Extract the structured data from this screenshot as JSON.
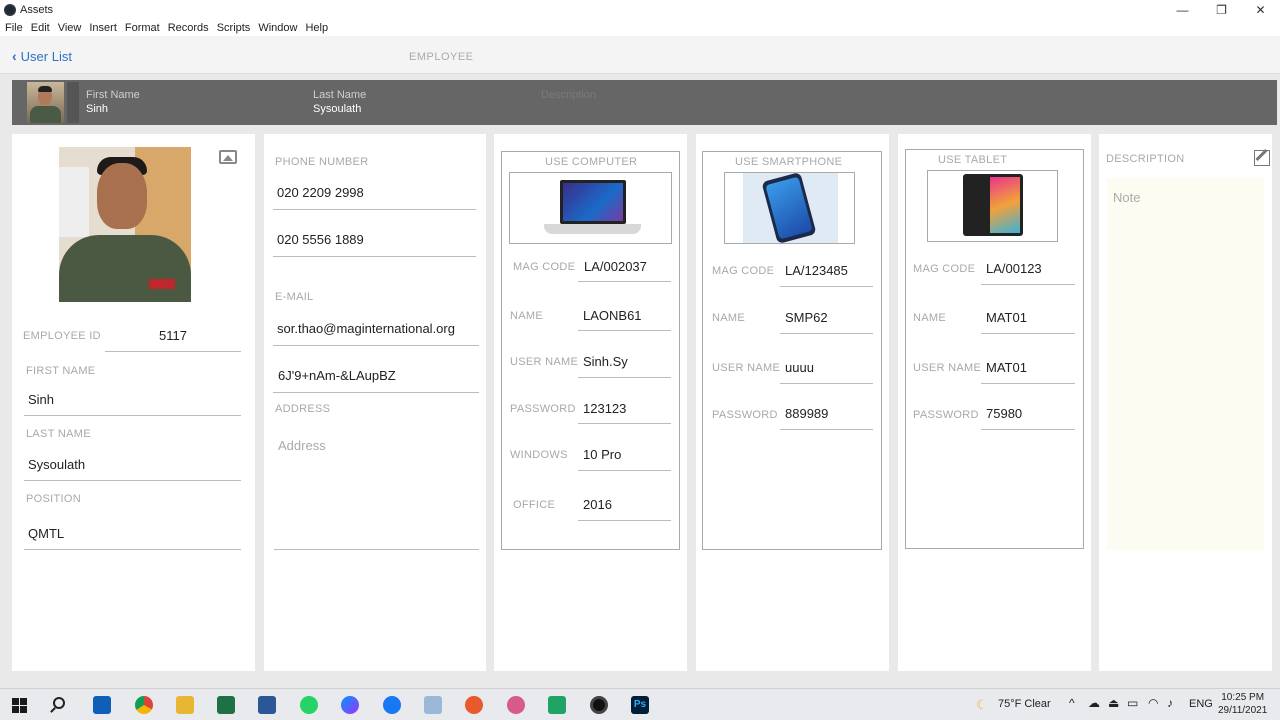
{
  "window": {
    "title": "Assets",
    "minimize": "—",
    "maximize": "❐",
    "close": "✕"
  },
  "menu": [
    "File",
    "Edit",
    "View",
    "Insert",
    "Format",
    "Records",
    "Scripts",
    "Window",
    "Help"
  ],
  "nav": {
    "back_label": "User List",
    "title": "EMPLOYEE"
  },
  "header": {
    "first_name_label": "First Name",
    "first_name": "Sinh",
    "last_name_label": "Last Name",
    "last_name": "Sysoulath",
    "description_label": "Description"
  },
  "employee": {
    "id_label": "EMPLOYEE ID",
    "id": "5117",
    "first_name_label": "FIRST NAME",
    "first_name": "Sinh",
    "last_name_label": "LAST NAME",
    "last_name": "Sysoulath",
    "position_label": "POSITION",
    "position": "QMTL"
  },
  "contact": {
    "phone_label": "PHONE NUMBER",
    "phone1": "020 2209 2998",
    "phone2": "020 5556 1889",
    "email_label": "E-MAIL",
    "email": "sor.thao@maginternational.org",
    "email2": "6J'9+nAm-&LAupBZ",
    "address_label": "ADDRESS",
    "address_placeholder": "Address"
  },
  "computer": {
    "title": "USE COMPUTER",
    "fields": [
      {
        "label": "MAG CODE",
        "value": "LA/002037"
      },
      {
        "label": "NAME",
        "value": "LAONB61"
      },
      {
        "label": "USER NAME",
        "value": "Sinh.Sy"
      },
      {
        "label": "PASSWORD",
        "value": "123123"
      },
      {
        "label": "WINDOWS",
        "value": "10 Pro"
      },
      {
        "label": "OFFICE",
        "value": "2016"
      }
    ]
  },
  "smartphone": {
    "title": "USE SMARTPHONE",
    "fields": [
      {
        "label": "MAG CODE",
        "value": "LA/123485"
      },
      {
        "label": "NAME",
        "value": "SMP62"
      },
      {
        "label": "USER NAME",
        "value": "uuuu"
      },
      {
        "label": "PASSWORD",
        "value": "889989"
      }
    ]
  },
  "tablet": {
    "title": "USE TABLET",
    "fields": [
      {
        "label": "MAG CODE",
        "value": "LA/00123"
      },
      {
        "label": "NAME",
        "value": "MAT01"
      },
      {
        "label": "USER NAME",
        "value": "MAT01"
      },
      {
        "label": "PASSWORD",
        "value": "75980"
      }
    ]
  },
  "description": {
    "label": "DESCRIPTION",
    "placeholder": "Note"
  },
  "taskbar": {
    "weather": "75°F  Clear",
    "lang": "ENG",
    "time": "10:25 PM",
    "date": "29/11/2021"
  }
}
